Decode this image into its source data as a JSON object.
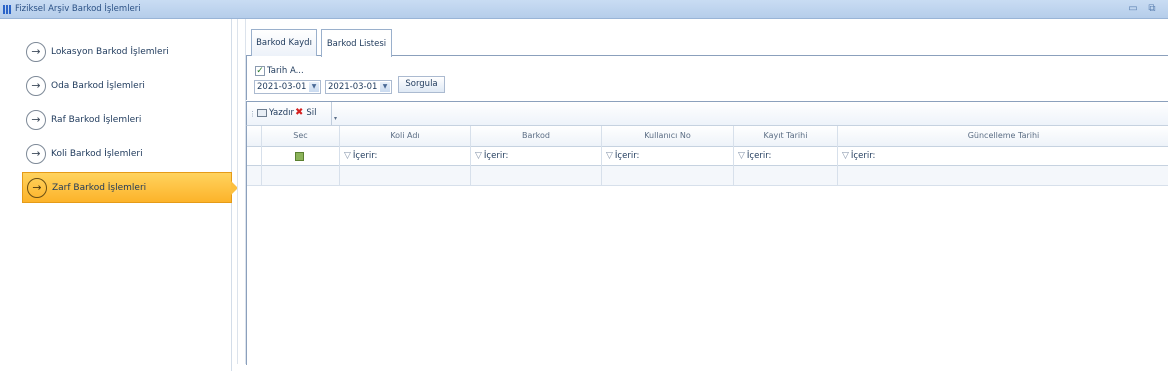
{
  "window": {
    "title": "Fiziksel Arşiv Barkod İşlemleri",
    "icon": "app-icon",
    "minimize_glyph": "▭",
    "restore_glyph": "⧉"
  },
  "nav": {
    "arrow_glyph": "→",
    "items": [
      {
        "label": "Lokasyon Barkod İşlemleri",
        "active": false
      },
      {
        "label": "Oda Barkod İşlemleri",
        "active": false
      },
      {
        "label": "Raf Barkod İşlemleri",
        "active": false
      },
      {
        "label": "Koli Barkod İşlemleri",
        "active": false
      },
      {
        "label": "Zarf Barkod İşlemleri",
        "active": true
      }
    ],
    "active_color": "#fcb32a"
  },
  "tabs": [
    {
      "label": "Barkod Kaydı",
      "selected": false
    },
    {
      "label": "Barkod Listesi",
      "selected": true
    }
  ],
  "filter": {
    "date_checkbox_label": "Tarih A...",
    "date_checkbox_checked": true,
    "check_glyph": "✓",
    "start_date": "2021-03-01",
    "end_date": "2021-03-01",
    "dropdown_glyph": "▼",
    "query_button": "Sorgula"
  },
  "toolbar": {
    "print_label": "Yazdır",
    "delete_label": "Sil",
    "delete_glyph": "✖",
    "grip_glyph": "⋮",
    "overflow_glyph": "▾"
  },
  "grid": {
    "columns": [
      "Sec",
      "Koli Adı",
      "Barkod",
      "Kullanıcı No",
      "Kayıt Tarihi",
      "Güncelleme Tarihi"
    ],
    "filter_placeholder": "İçerir:",
    "filter_glyph": "▽",
    "select_all_color": "#8bb35a",
    "rows": []
  }
}
